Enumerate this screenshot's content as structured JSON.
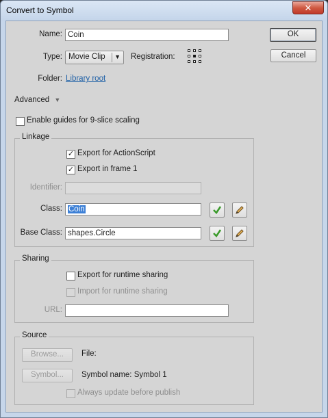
{
  "window": {
    "title": "Convert to Symbol",
    "close_glyph": "✕"
  },
  "form": {
    "name_label": "Name:",
    "name_value": "Coin",
    "type_label": "Type:",
    "type_value": "Movie Clip",
    "registration_label": "Registration:",
    "folder_label": "Folder:",
    "folder_value": "Library root",
    "advanced_label": "Advanced",
    "advanced_toggle_glyph": "▼",
    "nine_slice_label": "Enable guides for 9-slice scaling",
    "nine_slice_checked": false
  },
  "buttons": {
    "ok": "OK",
    "cancel": "Cancel"
  },
  "linkage": {
    "title": "Linkage",
    "export_actionscript_label": "Export for ActionScript",
    "export_actionscript_checked": true,
    "export_frame1_label": "Export in frame 1",
    "export_frame1_checked": true,
    "identifier_label": "Identifier:",
    "identifier_value": "",
    "class_label": "Class:",
    "class_value": "Coin",
    "base_class_label": "Base Class:",
    "base_class_value": "shapes.Circle"
  },
  "sharing": {
    "title": "Sharing",
    "export_runtime_label": "Export for runtime sharing",
    "export_runtime_checked": false,
    "import_runtime_label": "Import for runtime sharing",
    "import_runtime_checked": false,
    "url_label": "URL:",
    "url_value": ""
  },
  "source": {
    "title": "Source",
    "browse_label": "Browse...",
    "file_label": "File:",
    "symbol_button_label": "Symbol...",
    "symbol_name_text": "Symbol name: Symbol 1",
    "always_update_label": "Always update before publish",
    "always_update_checked": false
  },
  "colors": {
    "accent": "#3d80d6",
    "link": "#1d5fa6",
    "validate_green": "#3a9a2a"
  }
}
